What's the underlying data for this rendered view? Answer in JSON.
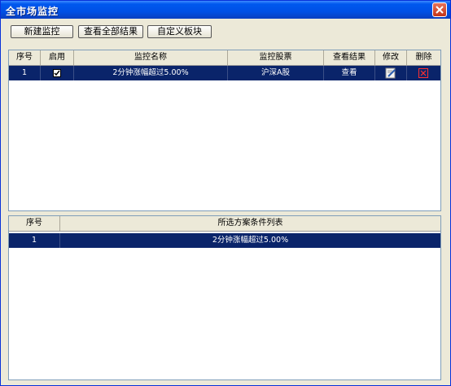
{
  "window": {
    "title": "全市场监控"
  },
  "toolbar": {
    "new_label": "新建监控",
    "view_all_label": "查看全部结果",
    "custom_block_label": "自定义板块"
  },
  "monitor_table": {
    "headers": [
      "序号",
      "启用",
      "监控名称",
      "监控股票",
      "查看结果",
      "修改",
      "删除"
    ],
    "rows": [
      {
        "index": "1",
        "enabled": true,
        "name": "2分钟涨幅超过5.00%",
        "stocks": "沪深A股",
        "view": "查看"
      }
    ]
  },
  "condition_table": {
    "headers": [
      "序号",
      "所选方案条件列表"
    ],
    "rows": [
      {
        "index": "1",
        "condition": "2分钟涨幅超过5.00%"
      }
    ]
  },
  "colors": {
    "selection": "#0a246a",
    "title_bar": "#0058ee",
    "close_button": "#c43518"
  }
}
